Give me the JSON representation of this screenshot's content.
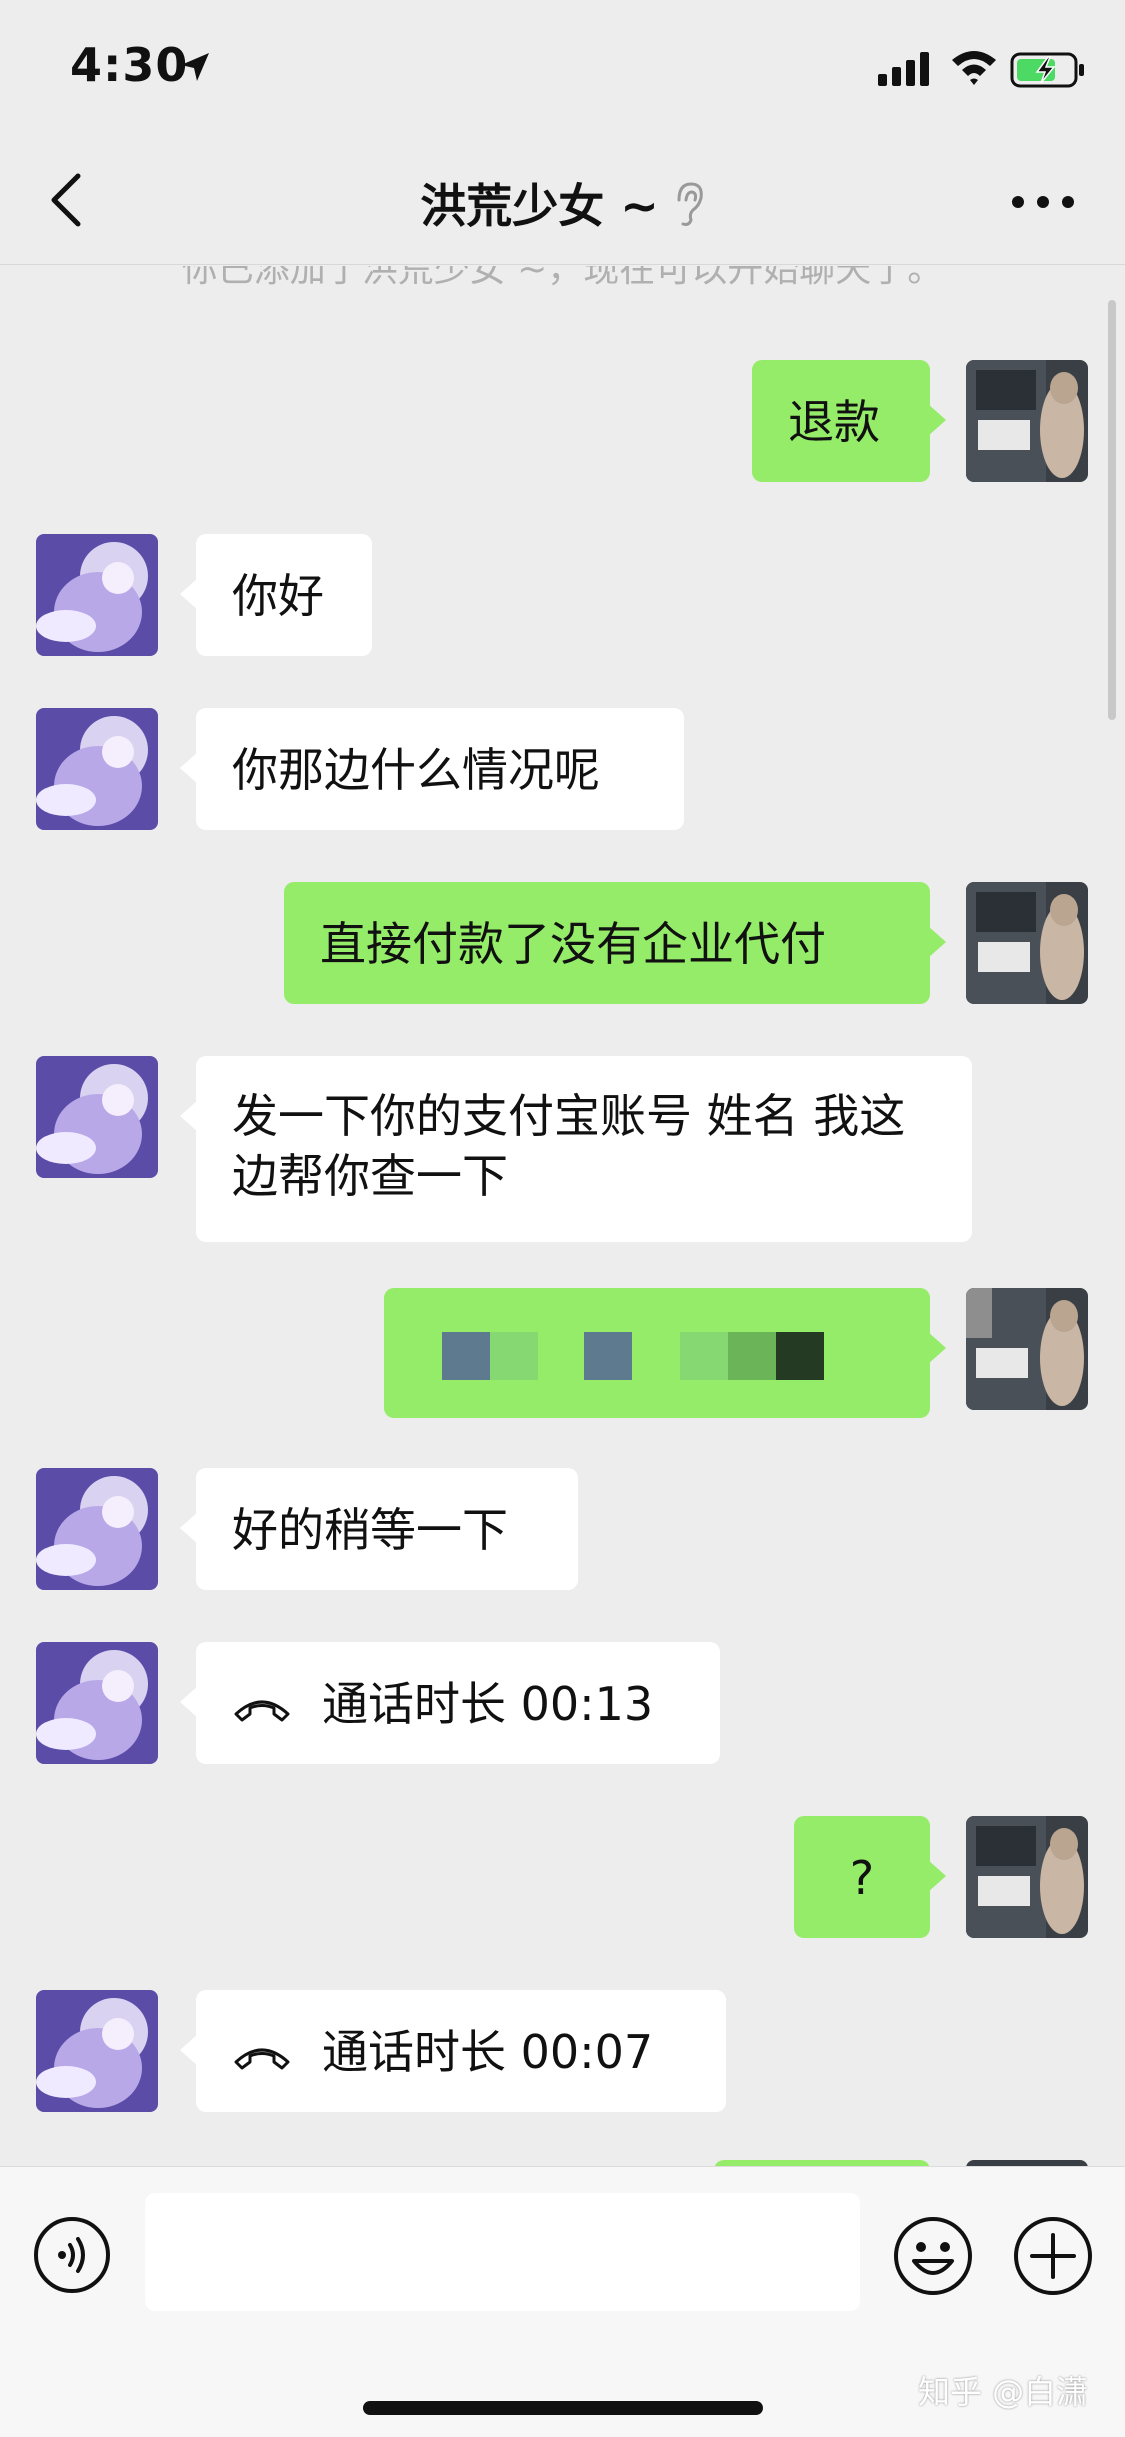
{
  "status_bar": {
    "time": "4:30",
    "icons": [
      "location-arrow-icon",
      "cellular-signal-icon",
      "wifi-icon",
      "battery-charging-icon"
    ]
  },
  "nav": {
    "title": "洪荒少女 ~",
    "back_icon": "chevron-left-icon",
    "ear_icon": "earpiece-mode-icon",
    "more_icon": "ellipsis-icon"
  },
  "system_notice": "你已添加了洪荒少女 ~，现在可以开始聊天了。",
  "messages": [
    {
      "side": "right",
      "text": "退款"
    },
    {
      "side": "left",
      "text": "你好"
    },
    {
      "side": "left",
      "text": "你那边什么情况呢"
    },
    {
      "side": "right",
      "text": "直接付款了没有企业代付"
    },
    {
      "side": "left",
      "text": "发一下你的支付宝账号 姓名 我这边帮你查一下"
    },
    {
      "side": "right",
      "text": "",
      "redacted": true
    },
    {
      "side": "left",
      "text": "好的稍等一下"
    },
    {
      "side": "left",
      "type": "call",
      "text": "通话时长 00:13",
      "icon": "hang-up-phone-icon"
    },
    {
      "side": "right",
      "text": "?"
    },
    {
      "side": "left",
      "type": "call",
      "text": "通话时长 00:07",
      "icon": "hang-up-phone-icon"
    }
  ],
  "input_bar": {
    "placeholder": "",
    "voice_icon": "voice-input-icon",
    "emoji_icon": "emoji-smile-icon",
    "plus_icon": "plus-circle-icon"
  },
  "watermark": "知乎 @白潇",
  "colors": {
    "background": "#ededed",
    "sent_bubble": "#95ec69",
    "received_bubble": "#ffffff"
  }
}
